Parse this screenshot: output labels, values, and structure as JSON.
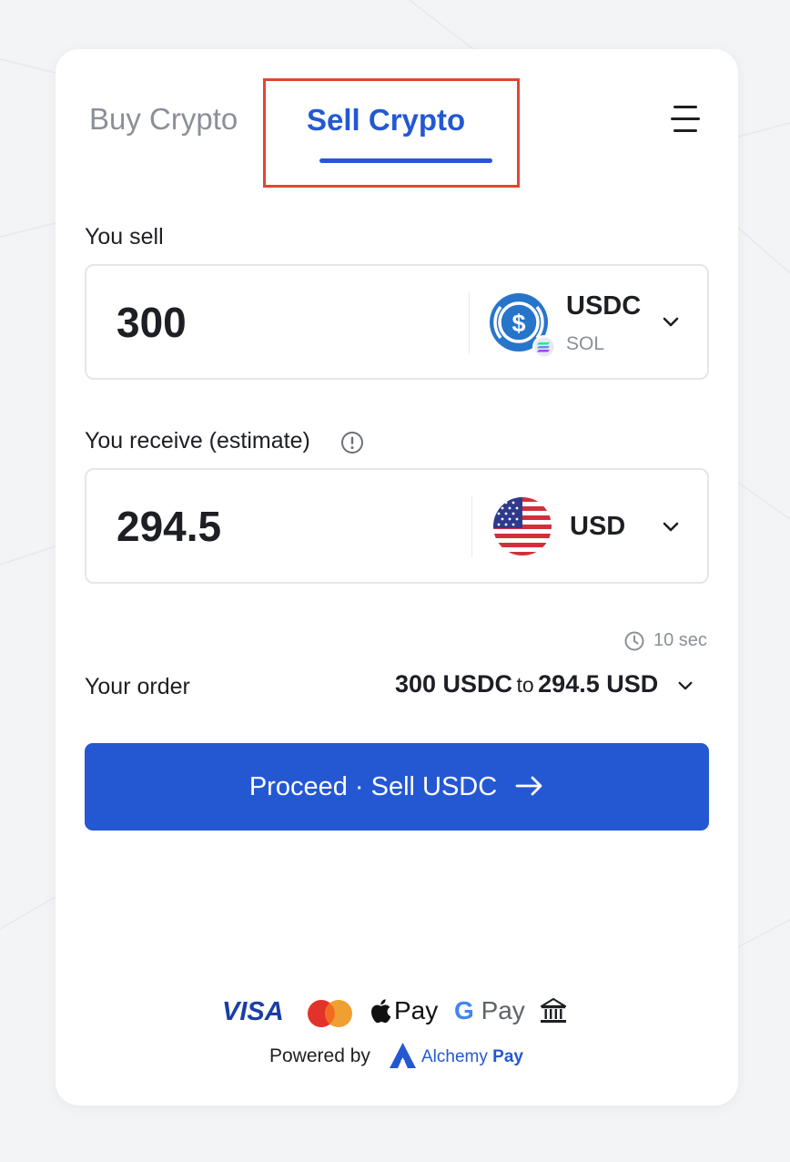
{
  "tabs": {
    "buy_label": "Buy Crypto",
    "sell_label": "Sell Crypto",
    "active": "sell"
  },
  "menu": {
    "icon": "hamburger-menu-icon"
  },
  "sell_section": {
    "label": "You sell",
    "amount": "300",
    "token": {
      "symbol": "USDC",
      "network": "SOL",
      "icon": "usdc-coin-icon",
      "badge_icon": "solana-badge-icon"
    }
  },
  "receive_section": {
    "label": "You receive (estimate)",
    "info_icon": "info-icon",
    "amount": "294.5",
    "currency": {
      "symbol": "USD",
      "icon": "us-flag-icon"
    }
  },
  "quote": {
    "refresh_timer": "10 sec",
    "icon": "clock-icon"
  },
  "order": {
    "label": "Your order",
    "from_amount": "300 USDC",
    "connector": "to",
    "to_amount": "294.5 USD"
  },
  "proceed": {
    "label": "Proceed · Sell USDC",
    "icon": "arrow-right-icon"
  },
  "payment_methods": {
    "visa_label": "VISA",
    "applepay_label": "Pay",
    "gpay_g": "G",
    "gpay_label": "Pay",
    "icons": [
      "visa-logo",
      "mastercard-logo",
      "apple-pay-logo",
      "google-pay-logo",
      "bank-icon"
    ]
  },
  "footer": {
    "powered_label": "Powered by",
    "brand_name": "Alchemy",
    "brand_suffix": "Pay"
  },
  "colors": {
    "accent": "#2458d3",
    "highlight_border": "#e2462f",
    "text": "#1d1f24",
    "muted": "#8b8f98"
  }
}
